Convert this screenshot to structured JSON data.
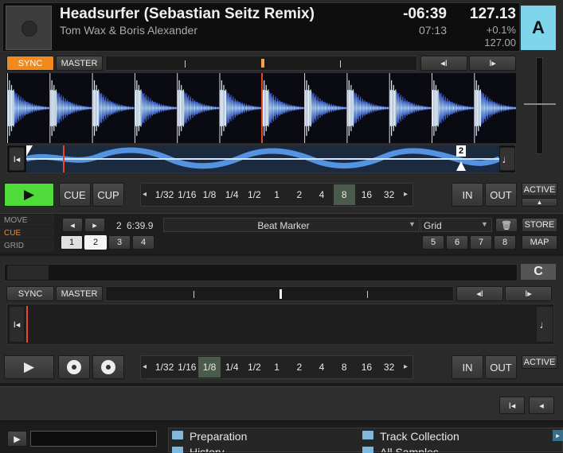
{
  "deckA": {
    "title": "Headsurfer (Sebastian Seitz Remix)",
    "artist": "Tom Wax & Boris Alexander",
    "remaining": "-06:39",
    "elapsed": "07:13",
    "bpm": "127.13",
    "tempo_offset": "+0.1%",
    "orig_bpm": "127.00",
    "letter": "A",
    "sync": "SYNC",
    "master": "MASTER",
    "play": "▶",
    "cue": "CUE",
    "cup": "CUP",
    "loops": [
      "1/32",
      "1/16",
      "1/8",
      "1/4",
      "1/2",
      "1",
      "2",
      "4",
      "8",
      "16",
      "32"
    ],
    "loop_selected": "8",
    "in": "IN",
    "out": "OUT",
    "active": "ACTIVE",
    "grid_marker": "2",
    "modes": [
      "MOVE",
      "CUE",
      "GRID"
    ],
    "active_mode": "CUE",
    "cue_number": "2",
    "cue_time": "6:39.9",
    "cue_type": "Beat Marker",
    "grid_type": "Grid",
    "store": "STORE",
    "map": "MAP",
    "hotcues": [
      "1",
      "2",
      "3",
      "4",
      "5",
      "6",
      "7",
      "8"
    ],
    "hotcue_selected": "2"
  },
  "deckC": {
    "letter": "C",
    "sync": "SYNC",
    "master": "MASTER",
    "play": "▶",
    "loops": [
      "1/32",
      "1/16",
      "1/8",
      "1/4",
      "1/2",
      "1",
      "2",
      "4",
      "8",
      "16",
      "32"
    ],
    "loop_selected": "1/8",
    "in": "IN",
    "out": "OUT",
    "active": "ACTIVE"
  },
  "browser": {
    "preparation": "Preparation",
    "track_collection": "Track Collection",
    "history": "History",
    "all_samples": "All Samples",
    "search_value": ""
  },
  "colors": {
    "sync_active": "#f08a1c",
    "play_active": "#4fdc3a",
    "deck_a_letter_bg": "#7fd6ec",
    "waveform": "#3a6fd8",
    "playhead": "#e8452a"
  }
}
